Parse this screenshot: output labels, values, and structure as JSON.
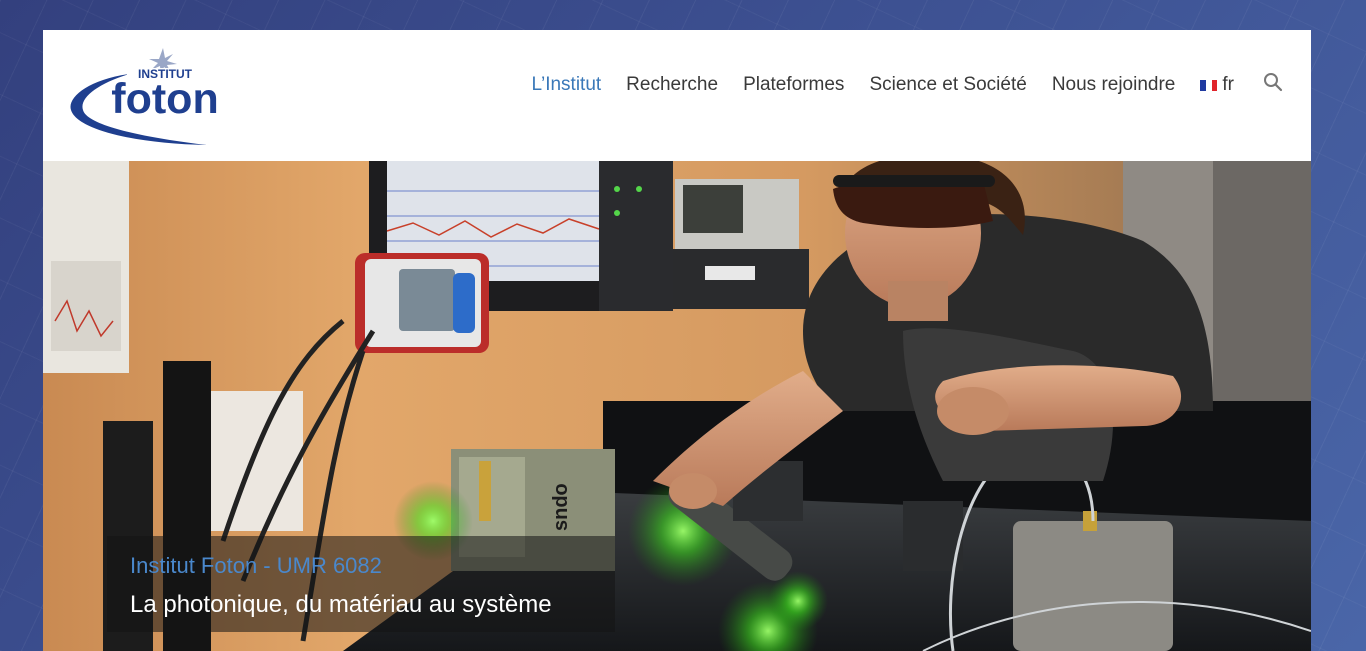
{
  "logo": {
    "top_text": "INSTITUT",
    "main_text": "foton",
    "icon": "star-icon"
  },
  "nav": {
    "items": [
      {
        "label": "L’Institut",
        "active": true
      },
      {
        "label": "Recherche",
        "active": false
      },
      {
        "label": "Plateformes",
        "active": false
      },
      {
        "label": "Science et Société",
        "active": false
      },
      {
        "label": "Nous rejoindre",
        "active": false
      }
    ],
    "language": {
      "label": "fr",
      "icon": "france-flag-icon"
    },
    "search_icon": "search-icon"
  },
  "hero": {
    "subtitle": "Institut Foton - UMR 6082",
    "title": "La photonique, du matériau au système"
  },
  "colors": {
    "accent": "#3a78b8",
    "logo_blue": "#1f3f8f",
    "nav_text": "#3a3a3a",
    "page_bg": "#3d5192",
    "laser_green": "#5dff3a"
  }
}
